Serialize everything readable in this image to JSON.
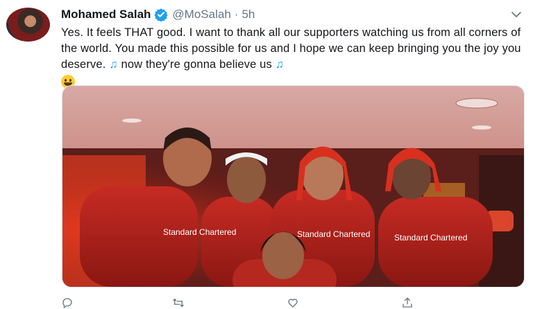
{
  "tweet": {
    "author_name": "Mohamed Salah",
    "handle": "@MoSalah",
    "separator": "·",
    "time": "5h",
    "text_main": "Yes. It feels THAT good. I want to thank all our supporters watching us from all corners of the world. You made this possible for us and I hope we can keep bringing you the joy you deserve. ",
    "text_note1": "♫",
    "text_mid": " now they're gonna believe us ",
    "text_note2": "♫",
    "photo_jersey_text_1": "Standard Chartered",
    "photo_jersey_text_2": "Standard Chartered",
    "photo_jersey_text_3": "Standard Chartered"
  },
  "icons": {
    "verified": "verified-badge-icon",
    "caret": "chevron-down-icon",
    "reply": "reply-icon",
    "retweet": "retweet-icon",
    "like": "heart-icon",
    "share": "share-icon"
  },
  "colors": {
    "accent": "#1da1f2",
    "muted": "#657786",
    "text": "#14171a",
    "photo_red": "#c0281f"
  }
}
